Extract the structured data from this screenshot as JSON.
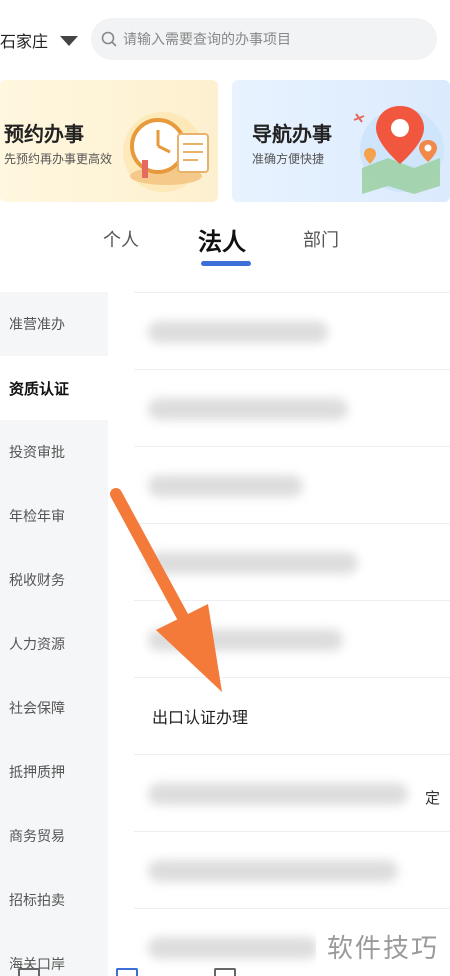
{
  "header": {
    "city": "石家庄",
    "search_placeholder": "请输入需要查询的办事项目"
  },
  "cards": {
    "appointment": {
      "title": "预约办事",
      "subtitle": "先预约再办事更高效"
    },
    "navigation": {
      "title": "导航办事",
      "subtitle": "准确方便快捷"
    }
  },
  "tabs": {
    "personal": "个人",
    "legal": "法人",
    "department": "部门",
    "active": "法人"
  },
  "sidebar": {
    "items": [
      {
        "label": "准营准办"
      },
      {
        "label": "资质认证"
      },
      {
        "label": "投资审批"
      },
      {
        "label": "年检年审"
      },
      {
        "label": "税收财务"
      },
      {
        "label": "人力资源"
      },
      {
        "label": "社会保障"
      },
      {
        "label": "抵押质押"
      },
      {
        "label": "商务贸易"
      },
      {
        "label": "招标拍卖"
      },
      {
        "label": "海关口岸"
      }
    ],
    "active": "资质认证"
  },
  "list": {
    "visible_item": "出口认证办理",
    "trailing_char": "定"
  },
  "watermark": "软件技巧",
  "colors": {
    "accent": "#3d6fd8",
    "arrow": "#f47a3a",
    "sidebar_bg": "#f5f6f8"
  }
}
